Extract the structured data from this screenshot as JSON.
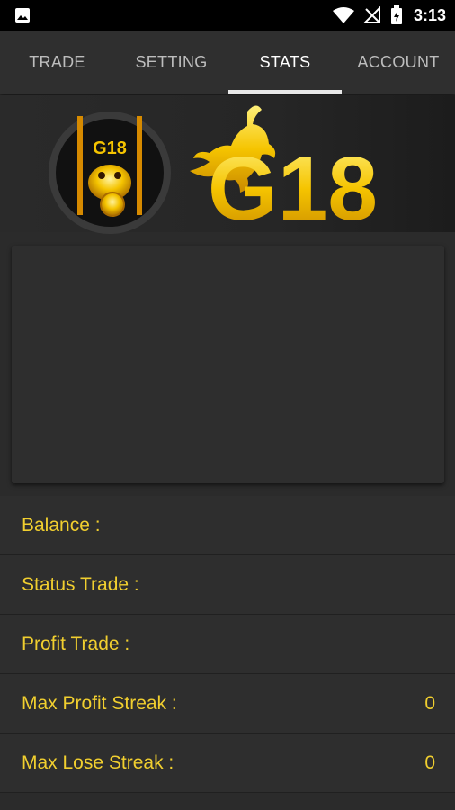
{
  "status_bar": {
    "time": "3:13",
    "icons": [
      "image-notification-icon",
      "wifi-icon",
      "no-signal-icon",
      "battery-charging-icon"
    ]
  },
  "tabs": [
    {
      "label": "TRADE",
      "active": false
    },
    {
      "label": "SETTING",
      "active": false
    },
    {
      "label": "STATS",
      "active": true
    },
    {
      "label": "ACCOUNT",
      "active": false
    }
  ],
  "banner": {
    "logo_text": "G18",
    "wordmark": "G18",
    "brand_color": "#f5c400"
  },
  "stats": [
    {
      "label": "Balance :",
      "value": ""
    },
    {
      "label": "Status Trade :",
      "value": ""
    },
    {
      "label": "Profit Trade :",
      "value": ""
    },
    {
      "label": "Max Profit Streak :",
      "value": "0"
    },
    {
      "label": "Max Lose Streak :",
      "value": "0"
    }
  ],
  "colors": {
    "accent_text": "#f1cf2f",
    "background": "#2b2b2b",
    "tab_bar": "#2f2f2f"
  }
}
